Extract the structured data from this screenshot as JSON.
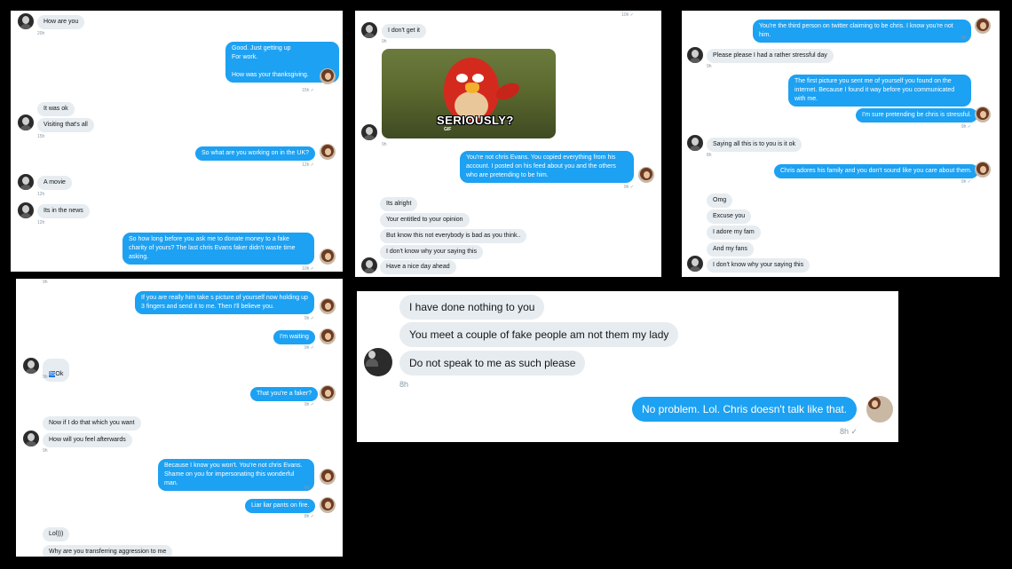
{
  "panel1": {
    "messages": [
      {
        "text": "How are you"
      },
      {
        "text": "Good.  Just getting up\nFor work.\n\nHow was your thanksgiving."
      },
      {
        "text": "It was ok"
      },
      {
        "text": "Visiting that's all"
      },
      {
        "text": "So what are you working on in the UK?"
      },
      {
        "text": "A movie"
      },
      {
        "text": "Its in the news"
      },
      {
        "text": "So how long before you ask me to donate money to a fake charity of yours?   The last chris Evans faker didn't waste time asking."
      }
    ],
    "timestamps": [
      "20h",
      "15h ✓",
      "15h",
      "12h ✓",
      "12h",
      "12h",
      "10h ✓"
    ]
  },
  "panel2": {
    "messages": [
      {
        "text": "I don't get it"
      },
      {
        "text": "You're not chris Evans.  You copied everything from his account.  I posted on his feed about you and the others who are pretending to be him."
      },
      {
        "text": "Its alright"
      },
      {
        "text": "Your entitled to your opinion"
      },
      {
        "text": "But know this not everybody is bad as you think.."
      },
      {
        "text": "I don't know why your saying this"
      },
      {
        "text": "Have a nice day ahead"
      }
    ],
    "gif_caption": "SERIOUSLY?",
    "gif_badge": "GIF",
    "timestamps": [
      "10h ✓",
      "9h",
      "9h",
      "9h ✓"
    ]
  },
  "panel3": {
    "messages": [
      {
        "text": "You're the third person on twitter claiming to be chris.  I know you're not him."
      },
      {
        "text": "Please please I had a rather stressful day"
      },
      {
        "text": "The first picture you sent me of yourself you found on the internet.  Because I found it way before you communicated with me."
      },
      {
        "text": "I'm sure pretending be chris is stressful."
      },
      {
        "text": "Saying all this is to you is it ok"
      },
      {
        "text": "Chris adores his family and you don't sound like you care about them."
      },
      {
        "text": "Omg"
      },
      {
        "text": "Excuse you"
      },
      {
        "text": "I adore my fam"
      },
      {
        "text": "And my fans"
      },
      {
        "text": "I don't know why your saying this"
      }
    ],
    "timestamps": [
      "9h ✓",
      "9h",
      "9h ✓",
      "8h",
      "9h ✓"
    ]
  },
  "panel4": {
    "messages": [
      {
        "text": "If you are really him take s picture of yourself now holding up 3 fingers and send it to me.  Then I'll believe you."
      },
      {
        "text": "I'm waiting"
      },
      {
        "text": "Ok",
        "highlight": "Its"
      },
      {
        "text": "That you're a faker?"
      },
      {
        "text": "Now if I do that which you want"
      },
      {
        "text": "How will you feel afterwards"
      },
      {
        "text": "Because I know you won't.  You're not chris Evans. Shame on you for impersonating this wonderful man."
      },
      {
        "text": "Liar liar pants on fire."
      },
      {
        "text": "Lol)))"
      },
      {
        "text": "Why are you transferring aggression to me"
      }
    ],
    "timestamps": [
      "9h",
      "9h ✓",
      "9h ✓",
      "9h",
      "9h ✓",
      "9h",
      "8h ✓",
      "8h ✓",
      "8h"
    ]
  },
  "panel5": {
    "messages": [
      {
        "text": "I have done nothing to you"
      },
      {
        "text": "You meet a couple of fake people am not them my lady"
      },
      {
        "text": "Do not speak to me as such please"
      },
      {
        "text": "No problem.  Lol.  Chris doesn't talk like that."
      }
    ],
    "timestamps": [
      "8h",
      "8h ✓"
    ]
  }
}
